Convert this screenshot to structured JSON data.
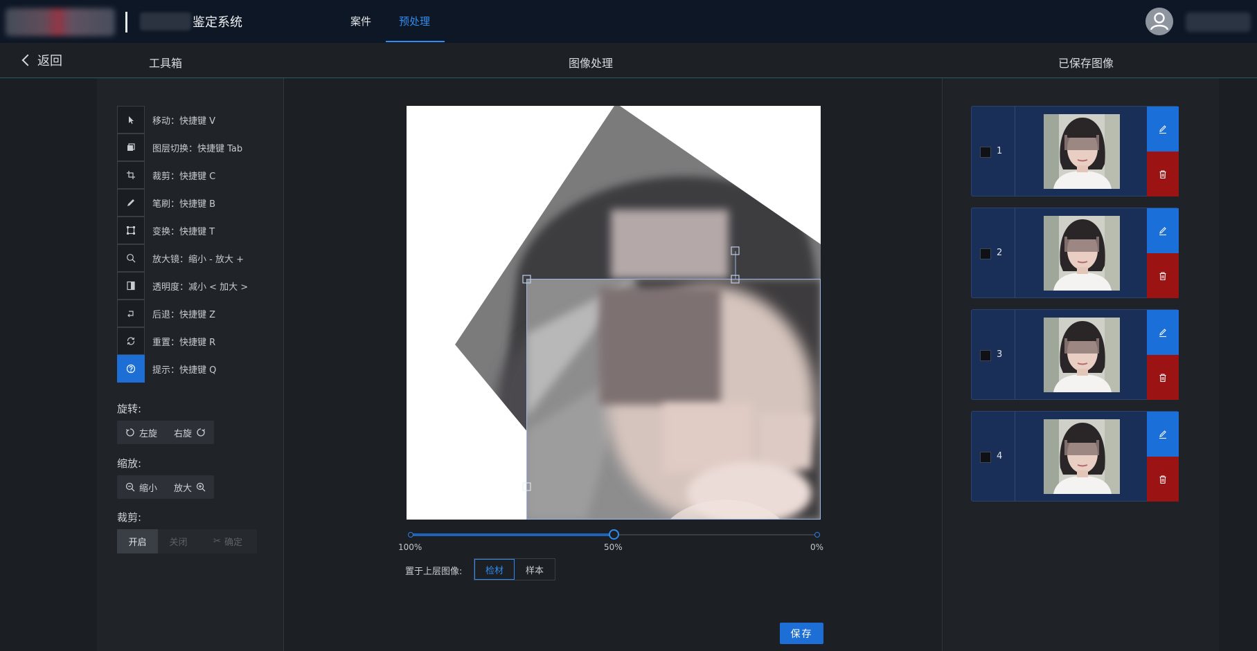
{
  "header": {
    "app_title": "鉴定系统",
    "nav": [
      {
        "label": "案件",
        "active": false
      },
      {
        "label": "预处理",
        "active": true
      }
    ]
  },
  "subheader": {
    "back_label": "返回",
    "toolbox_title": "工具箱",
    "image_processing_title": "图像处理",
    "saved_images_title": "已保存图像"
  },
  "tools": [
    {
      "icon": "pointer-icon",
      "label": "移动：快捷键 V",
      "active": false
    },
    {
      "icon": "layers-icon",
      "label": "图层切换：快捷键 Tab",
      "active": false
    },
    {
      "icon": "crop-icon",
      "label": "裁剪：快捷键 C",
      "active": false
    },
    {
      "icon": "brush-icon",
      "label": "笔刷：快捷键 B",
      "active": false
    },
    {
      "icon": "transform-icon",
      "label": "变换：快捷键 T",
      "active": false
    },
    {
      "icon": "magnifier-icon",
      "label": "放大镜：缩小 - 放大 +",
      "active": false
    },
    {
      "icon": "opacity-icon",
      "label": "透明度：减小 < 加大 >",
      "active": false
    },
    {
      "icon": "undo-icon",
      "label": "后退：快捷键 Z",
      "active": false
    },
    {
      "icon": "reset-icon",
      "label": "重置：快捷键 R",
      "active": false
    },
    {
      "icon": "help-icon",
      "label": "提示：快捷键 Q",
      "active": true
    }
  ],
  "rotate": {
    "title": "旋转:",
    "left": "左旋",
    "right": "右旋"
  },
  "zoom": {
    "title": "缩放:",
    "out": "缩小",
    "in": "放大"
  },
  "crop": {
    "title": "裁剪:",
    "on": "开启",
    "off": "关闭",
    "confirm": "确定",
    "state": "on"
  },
  "opacity_slider": {
    "labels": [
      "100%",
      "50%",
      "0%"
    ],
    "value_percent": 50
  },
  "layer_top": {
    "label": "置于上层图像:",
    "options": [
      "检材",
      "样本"
    ],
    "selected": "检材"
  },
  "save_label": "保存",
  "saved_images": [
    {
      "index": "1",
      "checked": false
    },
    {
      "index": "2",
      "checked": false
    },
    {
      "index": "3",
      "checked": false
    },
    {
      "index": "4",
      "checked": false
    }
  ],
  "colors": {
    "accent": "#2f8cf0",
    "primary_button": "#1d6fd6",
    "delete": "#9b1313",
    "card": "#1a2f57"
  }
}
